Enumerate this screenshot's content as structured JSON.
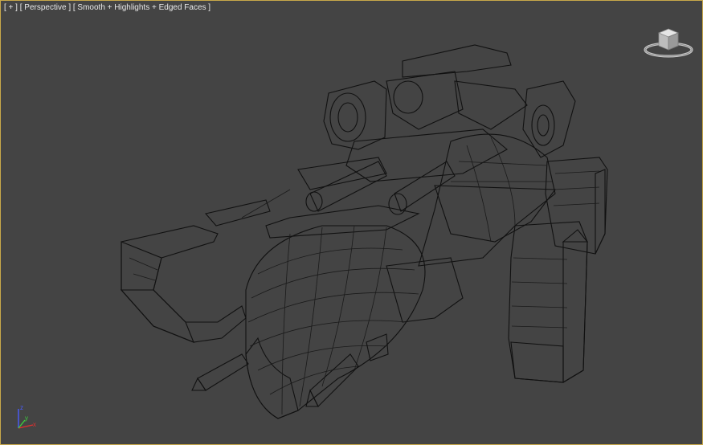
{
  "viewport": {
    "menu_plus": "[ + ]",
    "view_name": "[ Perspective ]",
    "shading_mode": "[ Smooth + Highlights + Edged Faces ]",
    "border_color": "#c8a84a",
    "background_color": "#444444"
  },
  "axis": {
    "z_label": "z",
    "y_label": "y",
    "x_label": "x",
    "z_color": "#4a5cff",
    "y_color": "#3ccf3c",
    "x_color": "#e03030"
  },
  "icons": {
    "viewcube": "viewcube-icon",
    "axis": "axis-tripod-icon"
  }
}
